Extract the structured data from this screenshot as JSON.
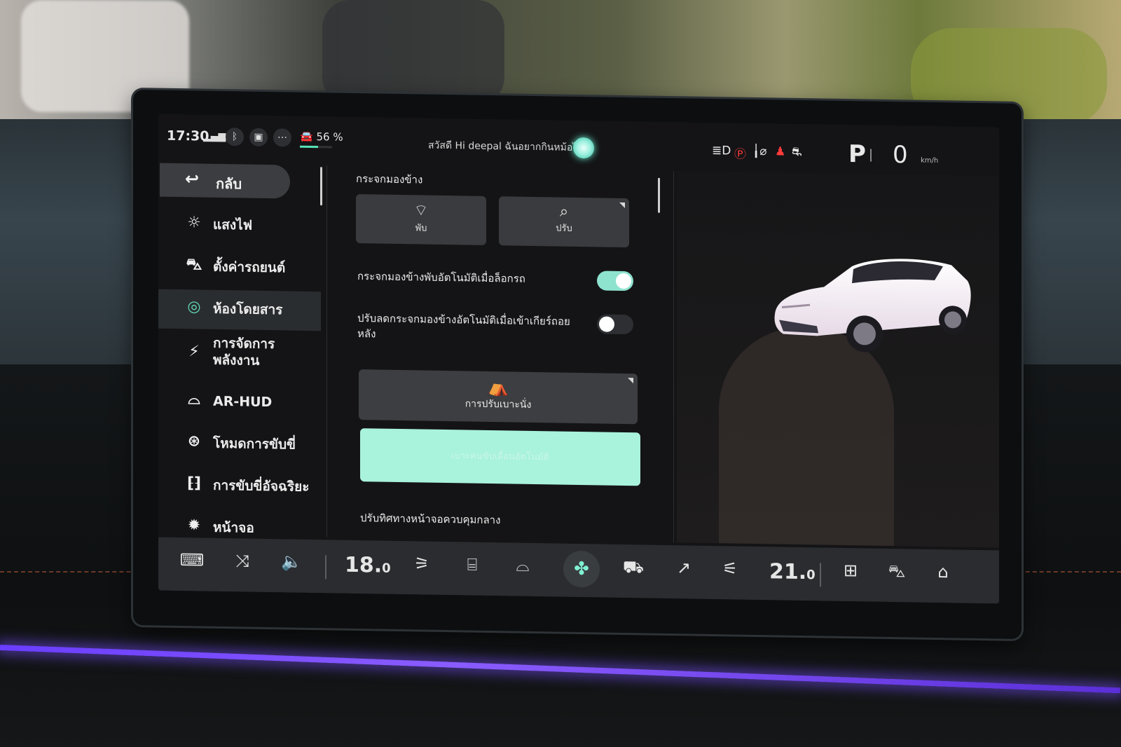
{
  "status": {
    "time": "17:30",
    "battery_percent": "56 %",
    "battery_level": 0.56,
    "greeting": "สวัสดี Hi deepal ฉันอยากกินหม้อไฟ",
    "gear": "P",
    "speed": "0",
    "speed_unit": "km/h",
    "icons": [
      "signal-icon",
      "bluetooth-icon",
      "camera-icon",
      "more-icon",
      "car-battery-icon",
      "headlight-icon",
      "parking-brake-icon",
      "seatbelt-icon",
      "airbag-icon",
      "tire-pressure-icon"
    ]
  },
  "sidebar": {
    "back_label": "กลับ",
    "items": [
      {
        "label": "แสงไฟ",
        "icon": "light-icon"
      },
      {
        "label": "ตั้งค่ารถยนต์",
        "icon": "car-icon"
      },
      {
        "label": "ห้องโดยสาร",
        "icon": "cabin-icon",
        "active": true
      },
      {
        "label": "การจัดการพลังงาน",
        "icon": "energy-icon"
      },
      {
        "label": "AR-HUD",
        "icon": "hud-icon"
      },
      {
        "label": "โหมดการขับขี่",
        "icon": "steering-icon"
      },
      {
        "label": "การขับขี่อัจฉริยะ",
        "icon": "smart-drive-icon"
      },
      {
        "label": "หน้าจอ",
        "icon": "display-icon"
      }
    ]
  },
  "content": {
    "section_title": "กระจกมองข้าง",
    "tile_fold": "พับ",
    "tile_adjust": "ปรับ",
    "auto_fold_label": "กระจกมองข้างพับอัตโนมัติเมื่อล็อกรถ",
    "auto_fold_on": true,
    "auto_tilt_label": "ปรับลดกระจกมองข้างอัตโนมัติเมื่อเข้าเกียร์ถอยหลัง",
    "auto_tilt_on": false,
    "seat_adjust_label": "การปรับเบาะนั่ง",
    "mint_button_label": "เบาะคนขับเลื่อนอัตโนมัติ",
    "section2_title": "ปรับทิศทางหน้าจอควบคุมกลาง"
  },
  "dock": {
    "left_temp": "18.",
    "left_temp_decimal": "0",
    "right_temp": "21.",
    "right_temp_decimal": "0",
    "accent": "#7ff0d2"
  },
  "colors": {
    "accent": "#5fd8b4",
    "toggle_on": "#8ee3cf",
    "mint_button": "#a9f2dc"
  }
}
